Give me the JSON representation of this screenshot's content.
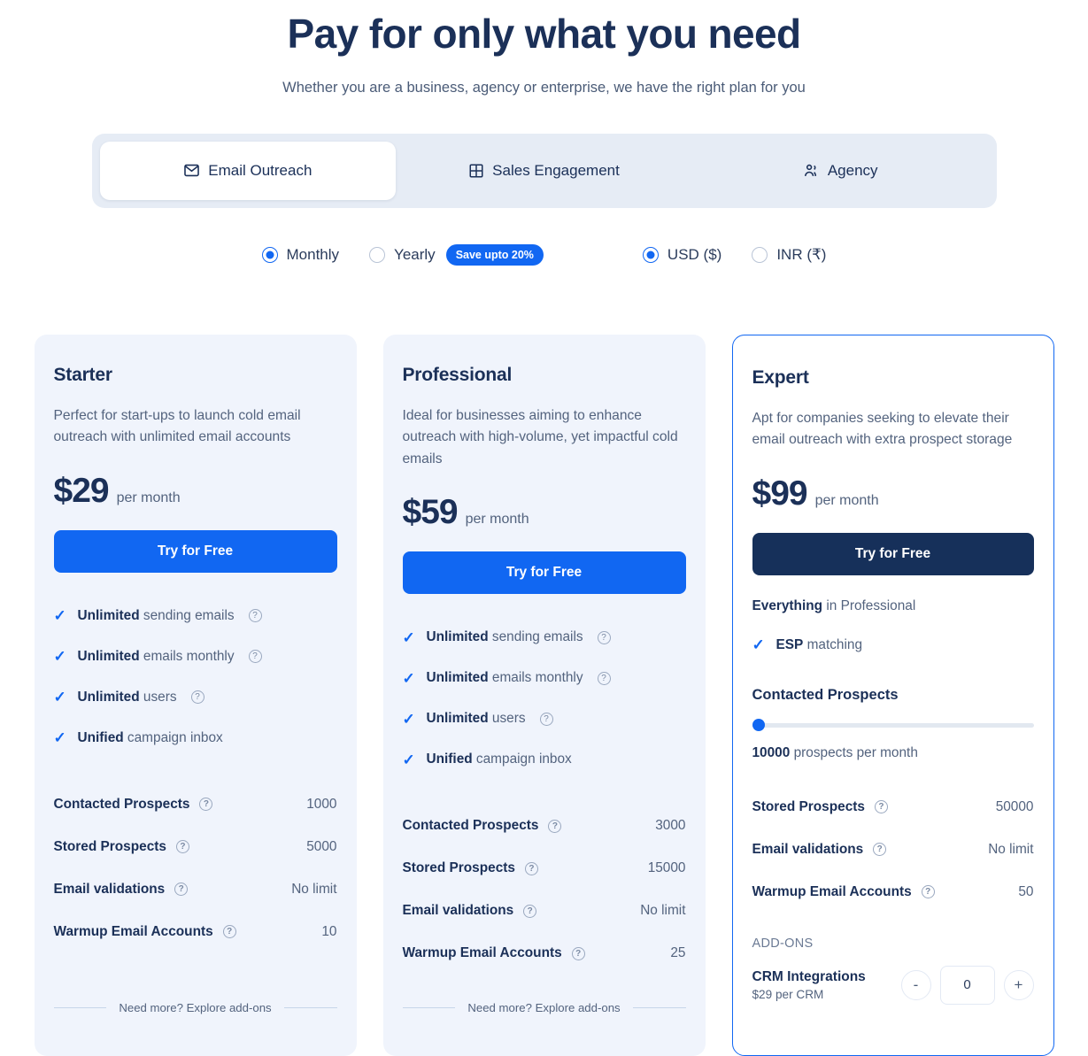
{
  "header": {
    "title": "Pay for only what you need",
    "subtitle": "Whether you are a business, agency or enterprise, we have the right plan for you"
  },
  "tabs": [
    {
      "label": "Email Outreach",
      "icon": "envelope-icon",
      "active": true
    },
    {
      "label": "Sales Engagement",
      "icon": "grid-icon",
      "active": false
    },
    {
      "label": "Agency",
      "icon": "people-icon",
      "active": false
    }
  ],
  "billing": {
    "monthly_label": "Monthly",
    "yearly_label": "Yearly",
    "save_badge": "Save upto 20%",
    "selected": "Monthly"
  },
  "currency": {
    "usd_label": "USD ($)",
    "inr_label": "INR (₹)",
    "selected": "USD ($)"
  },
  "colors": {
    "accent": "#1167f2",
    "dark": "#16305a",
    "card_bg": "#f0f4fc"
  },
  "footer_link": "Need more? Explore add-ons",
  "plans": [
    {
      "name": "Starter",
      "description": "Perfect for start-ups to launch cold email outreach with unlimited email accounts",
      "price": "$29",
      "price_period": "per month",
      "cta": "Try for Free",
      "features": [
        {
          "strong": "Unlimited",
          "rest": " sending emails",
          "info": true
        },
        {
          "strong": "Unlimited",
          "rest": " emails monthly",
          "info": true
        },
        {
          "strong": "Unlimited",
          "rest": " users",
          "info": true
        },
        {
          "strong": "Unified",
          "rest": " campaign inbox",
          "info": false
        }
      ],
      "specs": [
        {
          "label": "Contacted Prospects",
          "value": "1000"
        },
        {
          "label": "Stored Prospects",
          "value": "5000"
        },
        {
          "label": "Email validations",
          "value": "No limit"
        },
        {
          "label": "Warmup Email Accounts",
          "value": "10"
        }
      ]
    },
    {
      "name": "Professional",
      "description": "Ideal for businesses aiming to enhance outreach with high-volume, yet impactful cold emails",
      "price": "$59",
      "price_period": "per month",
      "cta": "Try for Free",
      "features": [
        {
          "strong": "Unlimited",
          "rest": " sending emails",
          "info": true
        },
        {
          "strong": "Unlimited",
          "rest": " emails monthly",
          "info": true
        },
        {
          "strong": "Unlimited",
          "rest": " users",
          "info": true
        },
        {
          "strong": "Unified",
          "rest": " campaign inbox",
          "info": false
        }
      ],
      "specs": [
        {
          "label": "Contacted Prospects",
          "value": "3000"
        },
        {
          "label": "Stored Prospects",
          "value": "15000"
        },
        {
          "label": "Email validations",
          "value": "No limit"
        },
        {
          "label": "Warmup Email Accounts",
          "value": "25"
        }
      ]
    }
  ],
  "expert": {
    "name": "Expert",
    "description": "Apt for companies seeking to elevate their email outreach with extra prospect storage",
    "price": "$99",
    "price_period": "per month",
    "cta": "Try for Free",
    "everything_strong": "Everything",
    "everything_rest": " in Professional",
    "esp_strong": "ESP",
    "esp_rest": " matching",
    "slider_title": "Contacted Prospects",
    "slider_value": "10000",
    "slider_note": " prospects per month",
    "slider_percent": 0,
    "specs": [
      {
        "label": "Stored Prospects",
        "value": "50000"
      },
      {
        "label": "Email validations",
        "value": "No limit"
      },
      {
        "label": "Warmup Email Accounts",
        "value": "50"
      }
    ],
    "addons_label": "ADD-ONS",
    "addon": {
      "name": "CRM Integrations",
      "price": "$29 per CRM",
      "minus": "-",
      "plus": "+",
      "quantity": "0"
    }
  }
}
